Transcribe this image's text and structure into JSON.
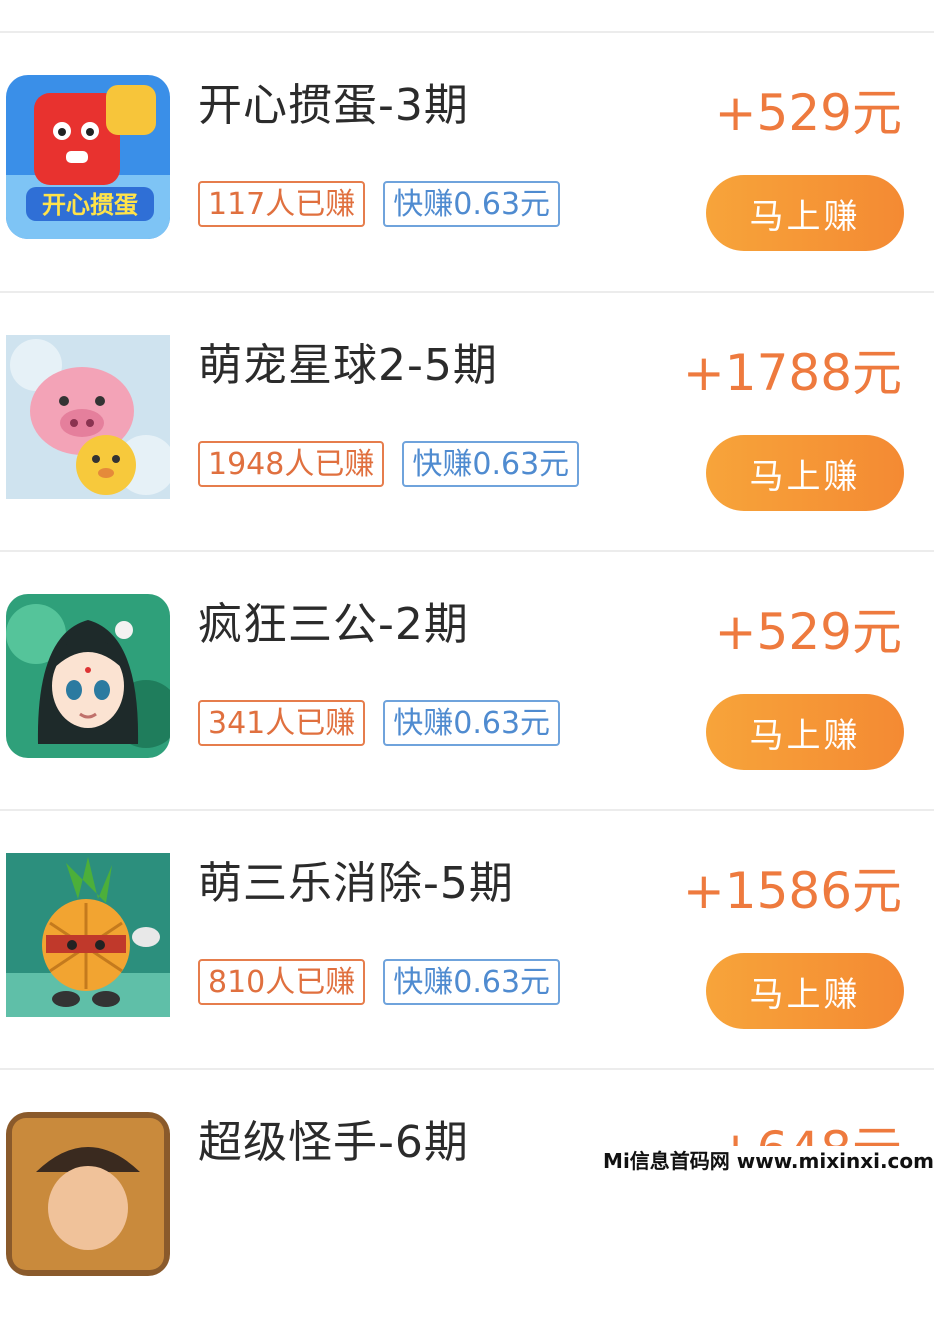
{
  "items": [
    {
      "title": "开心掼蛋-3期",
      "earned": "117人已赚",
      "quick": "快赚0.63元",
      "reward": "+529元",
      "button": "马上赚",
      "icon": "candy-block-game-icon"
    },
    {
      "title": "萌宠星球2-5期",
      "earned": "1948人已赚",
      "quick": "快赚0.63元",
      "reward": "+1788元",
      "button": "马上赚",
      "icon": "pet-pig-game-icon"
    },
    {
      "title": "疯狂三公-2期",
      "earned": "341人已赚",
      "quick": "快赚0.63元",
      "reward": "+529元",
      "button": "马上赚",
      "icon": "anime-girl-game-icon"
    },
    {
      "title": "萌三乐消除-5期",
      "earned": "810人已赚",
      "quick": "快赚0.63元",
      "reward": "+1586元",
      "button": "马上赚",
      "icon": "pineapple-warrior-game-icon"
    },
    {
      "title": "超级怪手-6期",
      "reward": "+648元",
      "icon": "pirate-game-icon"
    }
  ],
  "watermark": "Mi信息首码网 www.mixinxi.com",
  "colors": {
    "accent": "#ee7a3e",
    "button": "#f48a33",
    "quick_tag": "#4f8bd0"
  }
}
